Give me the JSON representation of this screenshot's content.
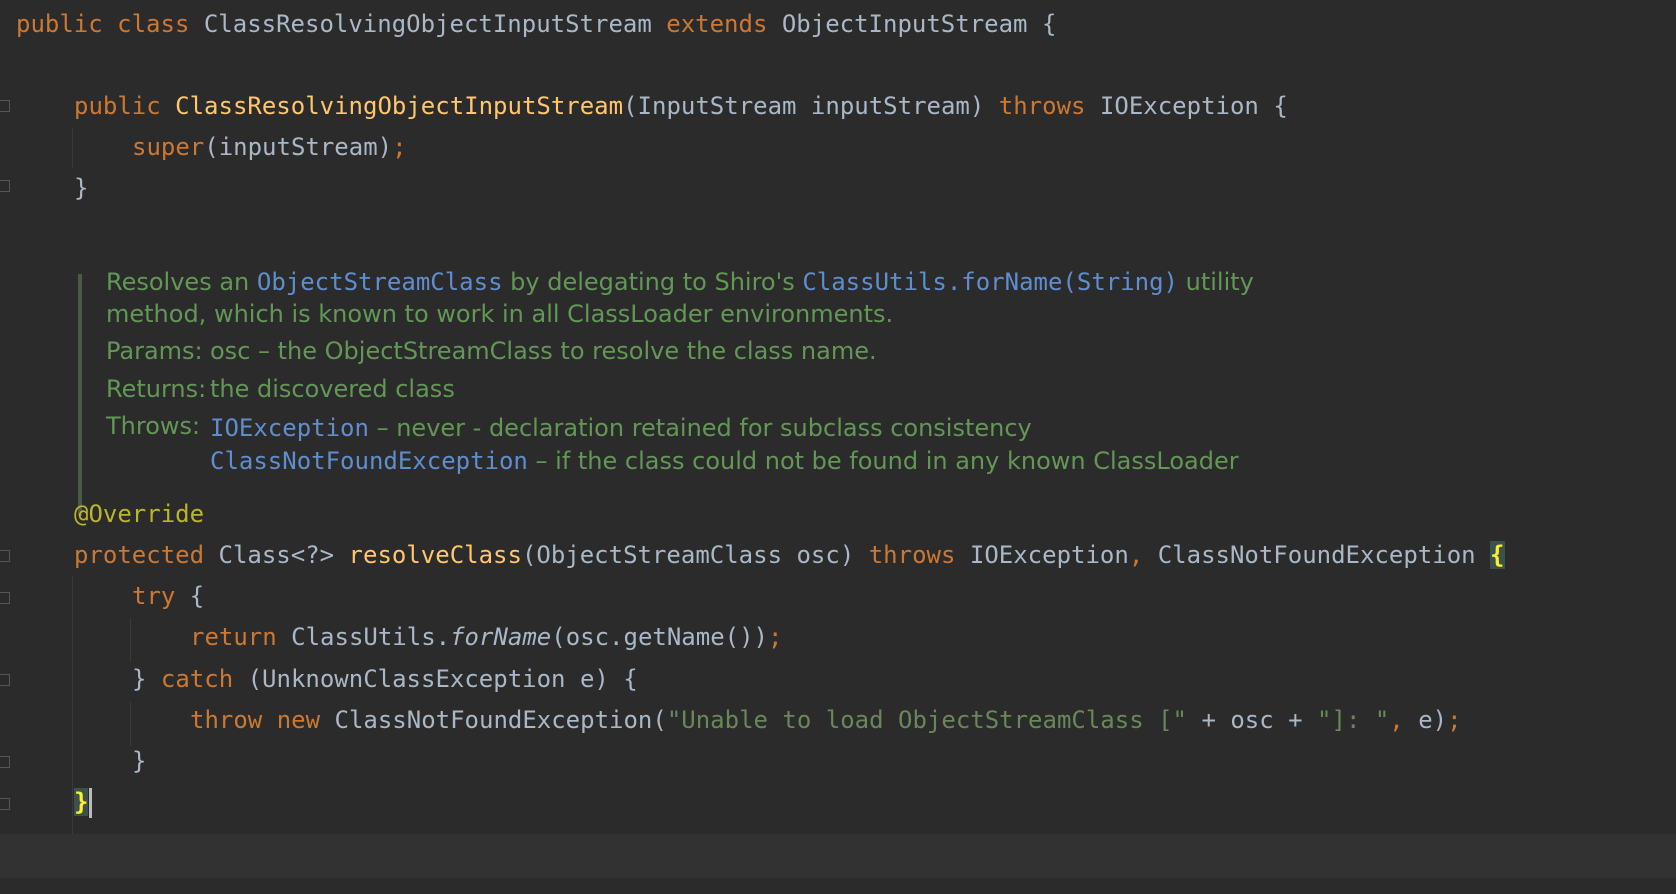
{
  "code": {
    "l1": {
      "public": "public",
      "class": "class",
      "name": "ClassResolvingObjectInputStream",
      "extends": "extends",
      "super_type": "ObjectInputStream",
      "brace": " {"
    },
    "l2": {
      "public": "public",
      "ctor": "ClassResolvingObjectInputStream",
      "params": "(InputStream inputStream) ",
      "throws": "throws",
      "exc": " IOException {"
    },
    "l3": {
      "super": "super",
      "args": "(inputStream)",
      "semi": ";"
    },
    "l4": {
      "brace": "}"
    },
    "l5": {
      "annotation": "@Override"
    },
    "l6": {
      "protected": "protected",
      "ret": " Class<?> ",
      "method": "resolveClass",
      "params": "(ObjectStreamClass osc) ",
      "throws": "throws",
      "exc1": " IOException",
      "comma": ",",
      "exc2": " ClassNotFoundException ",
      "brace": "{"
    },
    "l7": {
      "try": "try",
      "brace": " {"
    },
    "l8": {
      "return": "return",
      "cls": " ClassUtils.",
      "call": "forName",
      "args": "(osc.getName())",
      "semi": ";"
    },
    "l9": {
      "close": "} ",
      "catch": "catch",
      "args": " (UnknownClassException e) {"
    },
    "l10": {
      "throw": "throw",
      "new": " new",
      "cls": " ClassNotFoundException(",
      "s1": "\"Unable to load ObjectStreamClass [\"",
      "mid": " + osc + ",
      "s2": "\"]: \"",
      "comma": ",",
      "tail": " e)",
      "semi": ";"
    },
    "l11": {
      "brace": "}"
    },
    "l12": {
      "brace": "}"
    }
  },
  "javadoc": {
    "line1_a": "Resolves an ",
    "line1_link1": "ObjectStreamClass",
    "line1_b": " by delegating to Shiro's ",
    "line1_link2": "ClassUtils.forName(String)",
    "line1_c": " utility",
    "line2": "method, which is known to work in all ClassLoader environments.",
    "params_label": "Params:",
    "params_value": "osc – the ObjectStreamClass to resolve the class name.",
    "returns_label": "Returns:",
    "returns_value": "the discovered class",
    "throws_label": "Throws:",
    "throws1_link": "IOException",
    "throws1_text": " – never - declaration retained for subclass consistency",
    "throws2_link": "ClassNotFoundException",
    "throws2_text": " – if the class could not be found in any known ClassLoader"
  }
}
